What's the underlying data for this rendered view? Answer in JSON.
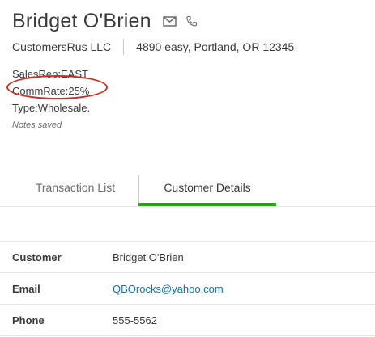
{
  "customer": {
    "name": "Bridget O'Brien",
    "company": "CustomersRus LLC",
    "address": "4890 easy, Portland, OR 12345",
    "email_icon": "envelope-icon",
    "phone_icon": "phone-icon"
  },
  "custom_fields": {
    "salesrep": "SalesRep:EAST",
    "commrate": "CommRate:25%",
    "type": "Type:Wholesale."
  },
  "notes_status": "Notes saved",
  "tabs": [
    {
      "label": "Transaction List",
      "active": false
    },
    {
      "label": "Customer Details",
      "active": true
    }
  ],
  "colors": {
    "active_tab_underline": "#2ca01c",
    "link": "#0077c5",
    "annotation_circle": "#d52b1e"
  },
  "details": [
    {
      "label": "Customer",
      "value": "Bridget O'Brien"
    },
    {
      "label": "Email",
      "value": "QBOrocks@yahoo.com"
    },
    {
      "label": "Phone",
      "value": "555-5562"
    }
  ]
}
